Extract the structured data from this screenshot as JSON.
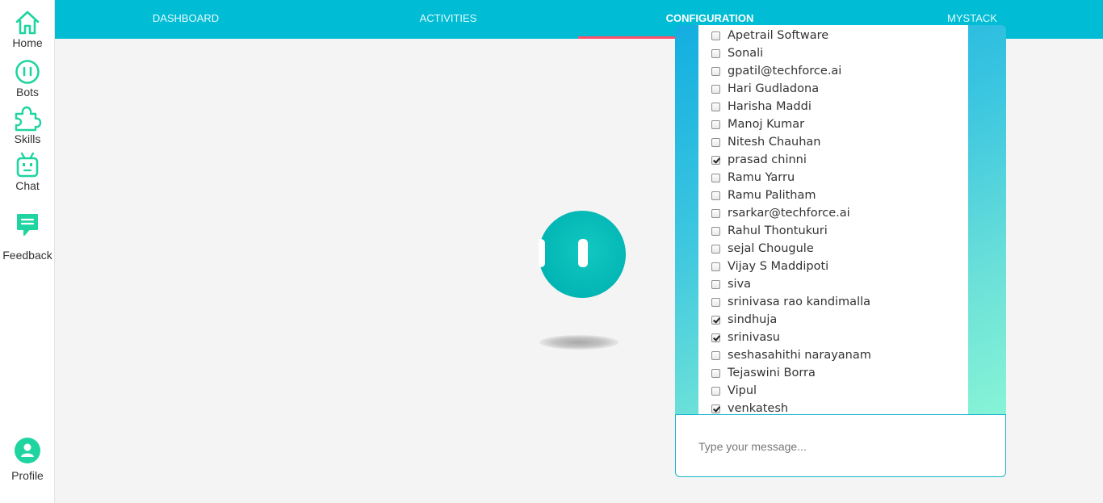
{
  "sidebar": {
    "items": [
      {
        "label": "Home",
        "icon": "home-icon"
      },
      {
        "label": "Bots",
        "icon": "bot-icon"
      },
      {
        "label": "Skills",
        "icon": "puzzle-icon"
      },
      {
        "label": "Chat",
        "icon": "robot-chat-icon"
      },
      {
        "label": "Feedback",
        "icon": "feedback-icon"
      }
    ],
    "profile": {
      "label": "Profile",
      "icon": "user-icon"
    }
  },
  "topnav": {
    "tabs": [
      {
        "label": "DASHBOARD",
        "active": false
      },
      {
        "label": "ACTIVITIES",
        "active": false
      },
      {
        "label": "CONFIGURATION",
        "active": true
      },
      {
        "label": "MYSTACK",
        "active": false
      }
    ]
  },
  "chat": {
    "users": [
      {
        "name": "Apetrail Software",
        "checked": false
      },
      {
        "name": "Sonali",
        "checked": false
      },
      {
        "name": "gpatil@techforce.ai",
        "checked": false
      },
      {
        "name": "Hari Gudladona",
        "checked": false
      },
      {
        "name": "Harisha Maddi",
        "checked": false
      },
      {
        "name": "Manoj Kumar",
        "checked": false
      },
      {
        "name": "Nitesh Chauhan",
        "checked": false
      },
      {
        "name": "prasad chinni",
        "checked": true
      },
      {
        "name": "Ramu Yarru",
        "checked": false
      },
      {
        "name": "Ramu Palitham",
        "checked": false
      },
      {
        "name": "rsarkar@techforce.ai",
        "checked": false
      },
      {
        "name": "Rahul Thontukuri",
        "checked": false
      },
      {
        "name": "sejal Chougule",
        "checked": false
      },
      {
        "name": "Vijay S Maddipoti",
        "checked": false
      },
      {
        "name": "siva",
        "checked": false
      },
      {
        "name": "srinivasa rao kandimalla",
        "checked": false
      },
      {
        "name": "sindhuja",
        "checked": true
      },
      {
        "name": "srinivasu",
        "checked": true
      },
      {
        "name": "seshasahithi narayanam",
        "checked": false
      },
      {
        "name": "Tejaswini Borra",
        "checked": false
      },
      {
        "name": "Vipul",
        "checked": false
      },
      {
        "name": "venkatesh",
        "checked": true
      }
    ],
    "input_placeholder": "Type your message..."
  },
  "colors": {
    "accent": "#00bcd4",
    "icon_green": "#1fd4a0",
    "active_underline": "#ff4f6a"
  }
}
